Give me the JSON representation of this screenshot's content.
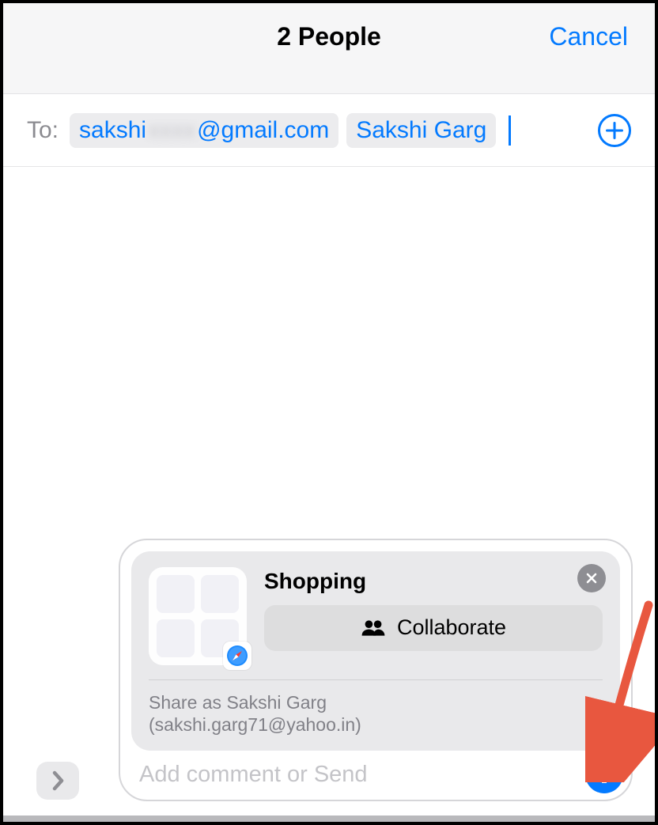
{
  "header": {
    "title": "2 People",
    "cancel_label": "Cancel"
  },
  "to_field": {
    "label": "To:",
    "recipients": [
      {
        "display_prefix": "sakshi",
        "display_suffix": "@gmail.com"
      },
      {
        "display": "Sakshi Garg"
      }
    ]
  },
  "attachment_card": {
    "title": "Shopping",
    "collaborate_label": "Collaborate",
    "share_as_line1": "Share as Sakshi Garg",
    "share_as_line2": "(sakshi.garg71@yahoo.in)"
  },
  "composer": {
    "placeholder": "Add comment or Send"
  },
  "icons": {
    "add_contact": "plus-circle-icon",
    "close": "close-icon",
    "safari": "safari-icon",
    "people": "people-icon",
    "send": "arrow-up-icon",
    "apps_toggle": "chevron-right-icon"
  },
  "colors": {
    "accent": "#037aff",
    "annotation_arrow": "#e8573f"
  }
}
